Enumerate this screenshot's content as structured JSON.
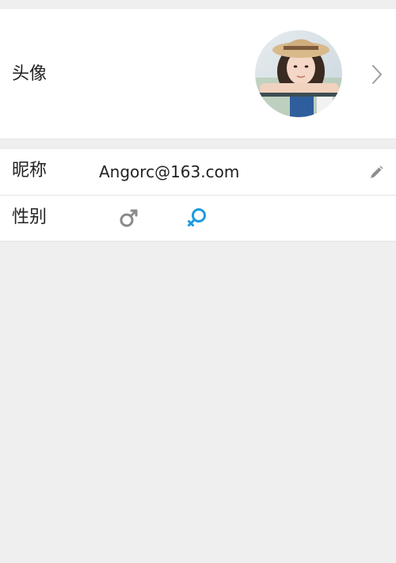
{
  "profile": {
    "avatar_label": "头像",
    "nickname_label": "昵称",
    "nickname_value": "Angorc@163.com",
    "gender_label": "性别",
    "gender_options": [
      {
        "name": "male",
        "icon": "male-icon",
        "selected": false,
        "color": "#8a8a8a"
      },
      {
        "name": "female",
        "icon": "female-icon",
        "selected": true,
        "color": "#1a9be0"
      }
    ]
  },
  "icons": {
    "chevron": "chevron-right-icon",
    "edit": "pencil-icon"
  },
  "colors": {
    "background": "#efefef",
    "card": "#ffffff",
    "accent": "#1a9be0",
    "muted_icon": "#8a8a8a"
  }
}
